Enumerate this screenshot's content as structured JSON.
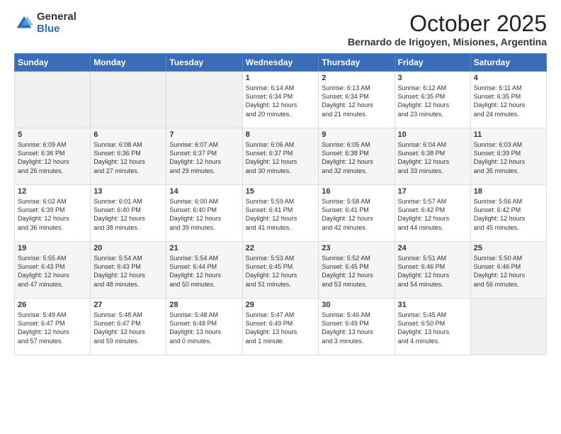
{
  "logo": {
    "general": "General",
    "blue": "Blue"
  },
  "header": {
    "month": "October 2025",
    "location": "Bernardo de Irigoyen, Misiones, Argentina"
  },
  "weekdays": [
    "Sunday",
    "Monday",
    "Tuesday",
    "Wednesday",
    "Thursday",
    "Friday",
    "Saturday"
  ],
  "weeks": [
    [
      {
        "day": "",
        "text": ""
      },
      {
        "day": "",
        "text": ""
      },
      {
        "day": "",
        "text": ""
      },
      {
        "day": "1",
        "text": "Sunrise: 6:14 AM\nSunset: 6:34 PM\nDaylight: 12 hours\nand 20 minutes."
      },
      {
        "day": "2",
        "text": "Sunrise: 6:13 AM\nSunset: 6:34 PM\nDaylight: 12 hours\nand 21 minutes."
      },
      {
        "day": "3",
        "text": "Sunrise: 6:12 AM\nSunset: 6:35 PM\nDaylight: 12 hours\nand 23 minutes."
      },
      {
        "day": "4",
        "text": "Sunrise: 6:11 AM\nSunset: 6:35 PM\nDaylight: 12 hours\nand 24 minutes."
      }
    ],
    [
      {
        "day": "5",
        "text": "Sunrise: 6:09 AM\nSunset: 6:36 PM\nDaylight: 12 hours\nand 26 minutes."
      },
      {
        "day": "6",
        "text": "Sunrise: 6:08 AM\nSunset: 6:36 PM\nDaylight: 12 hours\nand 27 minutes."
      },
      {
        "day": "7",
        "text": "Sunrise: 6:07 AM\nSunset: 6:37 PM\nDaylight: 12 hours\nand 29 minutes."
      },
      {
        "day": "8",
        "text": "Sunrise: 6:06 AM\nSunset: 6:37 PM\nDaylight: 12 hours\nand 30 minutes."
      },
      {
        "day": "9",
        "text": "Sunrise: 6:05 AM\nSunset: 6:38 PM\nDaylight: 12 hours\nand 32 minutes."
      },
      {
        "day": "10",
        "text": "Sunrise: 6:04 AM\nSunset: 6:38 PM\nDaylight: 12 hours\nand 33 minutes."
      },
      {
        "day": "11",
        "text": "Sunrise: 6:03 AM\nSunset: 6:39 PM\nDaylight: 12 hours\nand 35 minutes."
      }
    ],
    [
      {
        "day": "12",
        "text": "Sunrise: 6:02 AM\nSunset: 6:39 PM\nDaylight: 12 hours\nand 36 minutes."
      },
      {
        "day": "13",
        "text": "Sunrise: 6:01 AM\nSunset: 6:40 PM\nDaylight: 12 hours\nand 38 minutes."
      },
      {
        "day": "14",
        "text": "Sunrise: 6:00 AM\nSunset: 6:40 PM\nDaylight: 12 hours\nand 39 minutes."
      },
      {
        "day": "15",
        "text": "Sunrise: 5:59 AM\nSunset: 6:41 PM\nDaylight: 12 hours\nand 41 minutes."
      },
      {
        "day": "16",
        "text": "Sunrise: 5:58 AM\nSunset: 6:41 PM\nDaylight: 12 hours\nand 42 minutes."
      },
      {
        "day": "17",
        "text": "Sunrise: 5:57 AM\nSunset: 6:42 PM\nDaylight: 12 hours\nand 44 minutes."
      },
      {
        "day": "18",
        "text": "Sunrise: 5:56 AM\nSunset: 6:42 PM\nDaylight: 12 hours\nand 45 minutes."
      }
    ],
    [
      {
        "day": "19",
        "text": "Sunrise: 5:55 AM\nSunset: 6:43 PM\nDaylight: 12 hours\nand 47 minutes."
      },
      {
        "day": "20",
        "text": "Sunrise: 5:54 AM\nSunset: 6:43 PM\nDaylight: 12 hours\nand 48 minutes."
      },
      {
        "day": "21",
        "text": "Sunrise: 5:54 AM\nSunset: 6:44 PM\nDaylight: 12 hours\nand 50 minutes."
      },
      {
        "day": "22",
        "text": "Sunrise: 5:53 AM\nSunset: 6:45 PM\nDaylight: 12 hours\nand 51 minutes."
      },
      {
        "day": "23",
        "text": "Sunrise: 5:52 AM\nSunset: 6:45 PM\nDaylight: 12 hours\nand 53 minutes."
      },
      {
        "day": "24",
        "text": "Sunrise: 5:51 AM\nSunset: 6:46 PM\nDaylight: 12 hours\nand 54 minutes."
      },
      {
        "day": "25",
        "text": "Sunrise: 5:50 AM\nSunset: 6:46 PM\nDaylight: 12 hours\nand 56 minutes."
      }
    ],
    [
      {
        "day": "26",
        "text": "Sunrise: 5:49 AM\nSunset: 6:47 PM\nDaylight: 12 hours\nand 57 minutes."
      },
      {
        "day": "27",
        "text": "Sunrise: 5:48 AM\nSunset: 6:47 PM\nDaylight: 12 hours\nand 59 minutes."
      },
      {
        "day": "28",
        "text": "Sunrise: 5:48 AM\nSunset: 6:48 PM\nDaylight: 13 hours\nand 0 minutes."
      },
      {
        "day": "29",
        "text": "Sunrise: 5:47 AM\nSunset: 6:49 PM\nDaylight: 13 hours\nand 1 minute."
      },
      {
        "day": "30",
        "text": "Sunrise: 5:46 AM\nSunset: 6:49 PM\nDaylight: 13 hours\nand 3 minutes."
      },
      {
        "day": "31",
        "text": "Sunrise: 5:45 AM\nSunset: 6:50 PM\nDaylight: 13 hours\nand 4 minutes."
      },
      {
        "day": "",
        "text": ""
      }
    ]
  ]
}
